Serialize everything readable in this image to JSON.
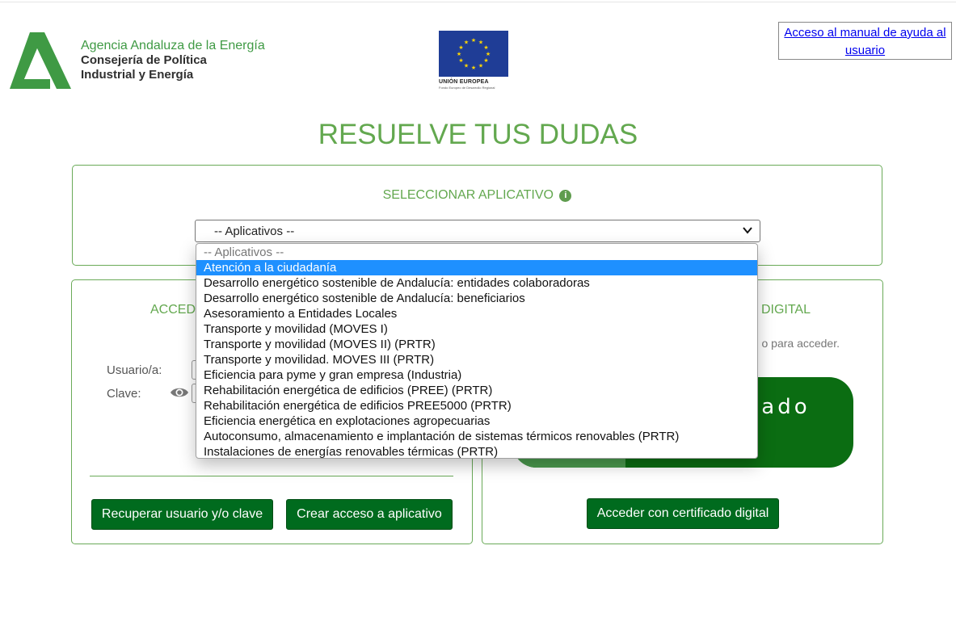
{
  "header": {
    "agency_name": "Agencia Andaluza de la Energía",
    "department_line1": "Consejería de Política",
    "department_line2": "Industrial y Energía",
    "eu_label": "UNIÓN EUROPEA",
    "eu_sublabel": "Fondo Europeo de Desarrollo Regional",
    "help_link": "Acceso al manual de ayuda al usuario"
  },
  "page_title": "RESUELVE TUS DUDAS",
  "select_section": {
    "label": "SELECCIONAR APLICATIVO",
    "info_icon": "info-circle-icon",
    "selected_value": "-- Aplicativos --"
  },
  "dropdown": {
    "options": [
      "-- Aplicativos --",
      "Atención a la ciudadanía",
      "Desarrollo energético sostenible de Andalucía: entidades colaboradoras",
      "Desarrollo energético sostenible de Andalucía: beneficiarios",
      "Asesoramiento a Entidades Locales",
      "Transporte y movilidad (MOVES I)",
      "Transporte y movilidad (MOVES II) (PRTR)",
      "Transporte y movilidad. MOVES III (PRTR)",
      "Eficiencia para pyme y gran empresa (Industria)",
      "Rehabilitación energética de edificios (PREE) (PRTR)",
      "Rehabilitación energética de edificios PREE5000 (PRTR)",
      "Eficiencia energética en explotaciones agropecuarias",
      "Autoconsumo, almacenamiento e implantación de sistemas térmicos renovables (PRTR)",
      "Instalaciones de energías renovables térmicas (PRTR)"
    ],
    "highlighted": "Atención a la ciudadanía"
  },
  "login_panel": {
    "title_visible": "ACCED",
    "user_label": "Usuario/a:",
    "password_label": "Clave:",
    "recover_button": "Recuperar usuario y/o clave",
    "create_button": "Crear acceso a aplicativo"
  },
  "cert_panel": {
    "title_visible": "DIGITAL",
    "text_visible": "o para acceder.",
    "graphic_text_visible": "cado",
    "cert_button": "Acceder con certificado digital"
  },
  "colors": {
    "brand_green": "#63a84f",
    "button_green": "#006b1e",
    "highlight_blue": "#1e90ff"
  }
}
